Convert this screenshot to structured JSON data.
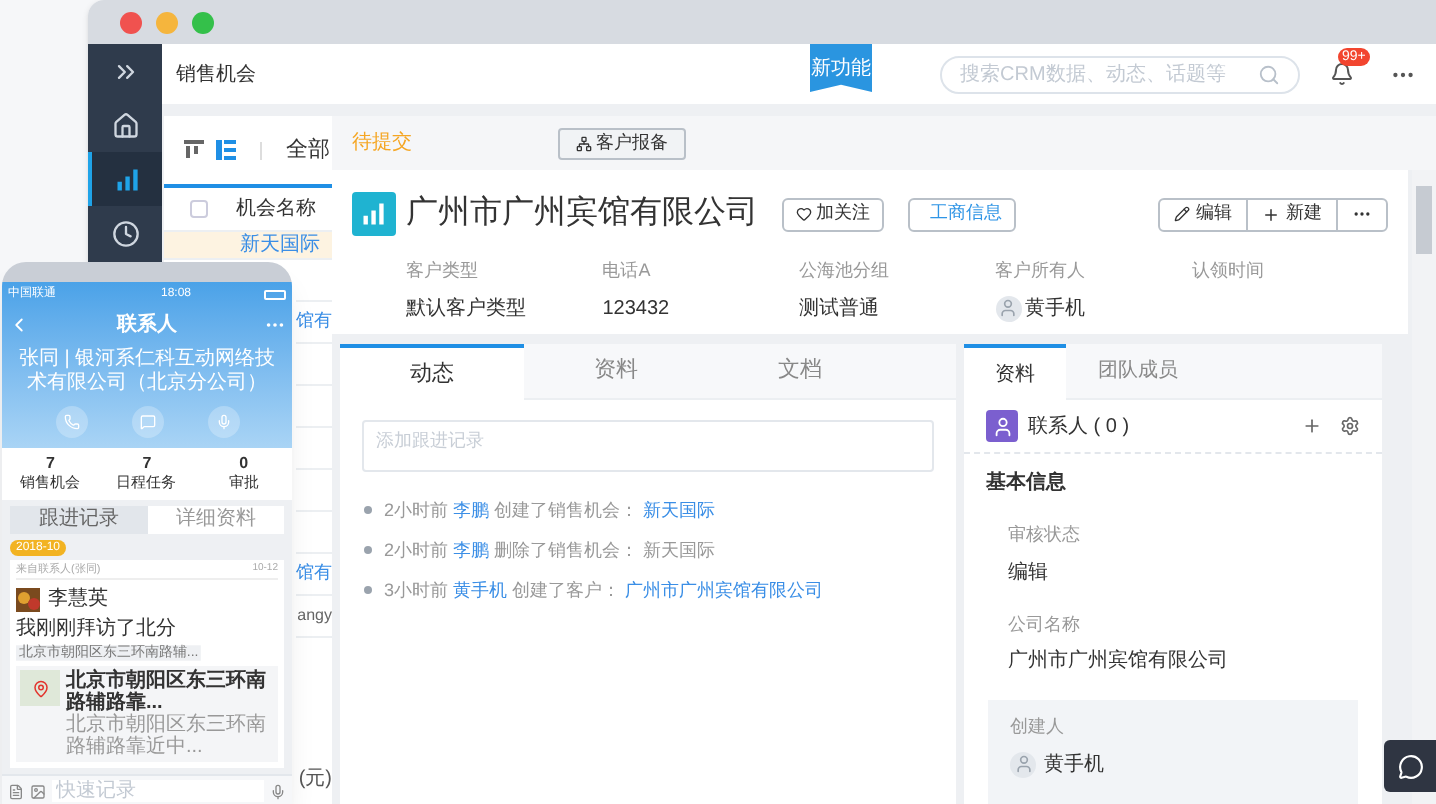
{
  "window": {
    "breadcrumb": "销售机会",
    "ribbon": "新功能",
    "search": {
      "placeholder": "搜索CRM数据、动态、话题等"
    },
    "notification_badge": "99+"
  },
  "sidebar": {
    "items": [
      {
        "kind": "expand",
        "selected": false
      },
      {
        "kind": "home",
        "selected": false
      },
      {
        "kind": "chart",
        "selected": true
      },
      {
        "kind": "clock",
        "selected": false
      }
    ]
  },
  "list_panel": {
    "view_toggles": [
      {
        "kind": "kanban",
        "selected": false
      },
      {
        "kind": "list",
        "selected": true
      }
    ],
    "filter": "全部",
    "column": "机会名称",
    "select_all_checked": false,
    "rows": [
      {
        "name": "新天国际",
        "kind": "link",
        "selected": true
      },
      {
        "selected": false
      },
      {
        "name": "馆有",
        "kind": "link",
        "selected": false
      },
      {
        "selected": false
      },
      {
        "selected": false
      },
      {
        "selected": false
      },
      {
        "selected": false
      },
      {
        "selected": false
      },
      {
        "name": "馆有",
        "kind": "link",
        "selected": false
      },
      {
        "name": "angy",
        "kind": "text",
        "selected": false
      }
    ],
    "footer": "(元)"
  },
  "detail": {
    "status": "待提交",
    "report_button": "客户报备",
    "title": "广州市广州宾馆有限公司",
    "follow_button": "加关注",
    "business_info_button": "工商信息",
    "actions": [
      {
        "kind": "edit",
        "label": "编辑"
      },
      {
        "kind": "new",
        "label": "新建"
      },
      {
        "kind": "more"
      }
    ],
    "fields": [
      {
        "label": "客户类型",
        "value": "默认客户类型"
      },
      {
        "label": "电话A",
        "value": "123432"
      },
      {
        "label": "公海池分组",
        "value": "测试普通"
      },
      {
        "label": "客户所有人",
        "value": "黄手机",
        "kind": "person"
      },
      {
        "label": "认领时间"
      }
    ]
  },
  "activity": {
    "tabs": [
      {
        "label": "动态",
        "selected": true
      },
      {
        "label": "资料",
        "selected": false
      },
      {
        "label": "文档",
        "selected": false
      }
    ],
    "input": {
      "placeholder": "添加跟进记录"
    },
    "items": [
      {
        "time": "2小时前",
        "user": "李鹏",
        "action": "创建了销售机会：",
        "target": "新天国际",
        "target_link": true
      },
      {
        "time": "2小时前",
        "user": "李鹏",
        "action": "删除了销售机会：",
        "target": "新天国际",
        "target_link": false
      },
      {
        "time": "3小时前",
        "user": "黄手机",
        "action": "创建了客户：",
        "target": "广州市广州宾馆有限公司",
        "target_link": true
      }
    ]
  },
  "info_panel": {
    "tabs": [
      {
        "label": "资料",
        "selected": true
      },
      {
        "label": "团队成员",
        "selected": false
      }
    ],
    "contacts": "联系人 ( 0 )",
    "section": "基本信息",
    "fields": [
      {
        "label": "审核状态",
        "value": "编辑"
      },
      {
        "label": "公司名称",
        "value": "广州市广州宾馆有限公司"
      }
    ],
    "creator": {
      "label": "创建人",
      "value": "黄手机"
    }
  },
  "phone": {
    "carrier": "中国联通",
    "time": "18:08",
    "title": "联系人",
    "company": "张同 | 银河系仁科互动网络技术有限公司（北京分公司）",
    "stats": [
      {
        "value": "7",
        "label": "销售机会"
      },
      {
        "value": "7",
        "label": "日程任务"
      },
      {
        "value": "0",
        "label": "审批"
      }
    ],
    "tabs": [
      {
        "label": "跟进记录",
        "selected": true
      },
      {
        "label": "详细资料",
        "selected": false
      }
    ],
    "date_tag": "2018-10",
    "source": "来自联系人(张同)",
    "source_time": "10-12",
    "post": {
      "author": "李慧英",
      "text": "我刚刚拜访了北分",
      "location": "北京市朝阳区东三环南路辅...",
      "map_title": "北京市朝阳区东三环南路辅路靠...",
      "map_address": "北京市朝阳区东三环南路辅路靠近中..."
    },
    "input": {
      "placeholder": "快速记录"
    }
  }
}
